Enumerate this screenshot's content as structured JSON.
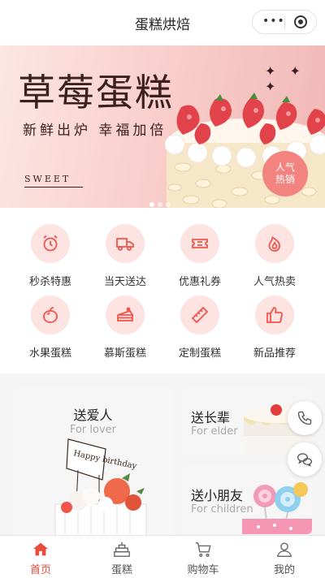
{
  "navbar": {
    "title": "蛋糕烘焙"
  },
  "banner": {
    "title": "草莓蛋糕",
    "subtitle": "新鲜出炉  幸福加倍",
    "tag": "SWEET",
    "stars": "✦ ✦ ✦",
    "badge_line1": "人气",
    "badge_line2": "热销",
    "slide_count": 3,
    "active_slide": 1
  },
  "menu": {
    "items": [
      {
        "label": "秒杀特惠",
        "icon": "alarm-clock-icon"
      },
      {
        "label": "当天送达",
        "icon": "delivery-truck-icon"
      },
      {
        "label": "优惠礼券",
        "icon": "coupon-ticket-icon"
      },
      {
        "label": "人气热卖",
        "icon": "fire-icon"
      },
      {
        "label": "水果蛋糕",
        "icon": "peach-icon"
      },
      {
        "label": "慕斯蛋糕",
        "icon": "cake-slice-icon"
      },
      {
        "label": "定制蛋糕",
        "icon": "ruler-icon"
      },
      {
        "label": "新品推荐",
        "icon": "thumbs-up-icon"
      }
    ]
  },
  "categories": {
    "lover": {
      "title": "送爱人",
      "subtitle": "For lover"
    },
    "elder": {
      "title": "送长辈",
      "subtitle": "For elder"
    },
    "children": {
      "title": "送小朋友",
      "subtitle": "For children"
    }
  },
  "topper_text": "Happy birthday",
  "tabbar": {
    "items": [
      {
        "label": "首页",
        "icon": "home-icon",
        "active": true
      },
      {
        "label": "蛋糕",
        "icon": "cake-icon",
        "active": false
      },
      {
        "label": "购物车",
        "icon": "cart-icon",
        "active": false
      },
      {
        "label": "我的",
        "icon": "user-icon",
        "active": false
      }
    ]
  },
  "colors": {
    "accent": "#e94b3c",
    "icon_bg": "#fde3e1",
    "icon_stroke": "#f0544a"
  }
}
